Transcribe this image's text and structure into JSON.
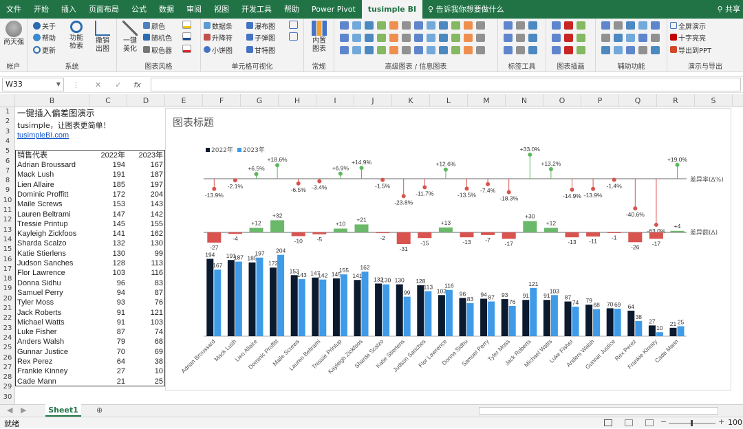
{
  "menu": {
    "tabs": [
      "文件",
      "开始",
      "插入",
      "页面布局",
      "公式",
      "数据",
      "审阅",
      "视图",
      "开发工具",
      "帮助",
      "Power Pivot",
      "tusimple BI"
    ],
    "active_tab": "tusimple BI",
    "tell_me": "告诉我你想要做什么",
    "share": "共享"
  },
  "ribbon": {
    "account": {
      "user": "尚天强",
      "group": "帐户"
    },
    "system": {
      "about": "关于",
      "help": "帮助",
      "update": "更新",
      "search": "功能检索",
      "undo": "撤销出图",
      "group": "系统"
    },
    "chart_style": {
      "beautify": "一键美化",
      "color": "颜色",
      "random_color": "随机色",
      "picker": "取色器",
      "group": "图表风格"
    },
    "cell_viz": {
      "databar": "数据条",
      "updown": "升降符",
      "pie": "小饼图",
      "waterfall": "瀑布图",
      "bullet": "子弹图",
      "sparkline": "甘特图",
      "group": "单元格可视化"
    },
    "common": {
      "builtin": "内置图表",
      "group": "常规"
    },
    "advanced": {
      "group": "高级图表 / 信息图表"
    },
    "label": {
      "group": "标签工具"
    },
    "theme": {
      "group": "图表插画"
    },
    "assist": {
      "group": "辅助功能"
    },
    "export": {
      "fullscreen": "全屏演示",
      "crosshair": "十字亮亮",
      "ppt": "导出到PPT",
      "group": "演示与导出"
    }
  },
  "formula_bar": {
    "name_box": "W33",
    "fx": "fx",
    "cancel": "✕",
    "confirm": "✓"
  },
  "columns": [
    "B",
    "C",
    "D",
    "E",
    "F",
    "G",
    "H",
    "I",
    "J",
    "K",
    "L",
    "M",
    "N",
    "O",
    "P",
    "Q",
    "R",
    "S"
  ],
  "rows": [
    "1",
    "2",
    "3",
    "4",
    "5",
    "6",
    "7",
    "8",
    "9",
    "10",
    "11",
    "12",
    "13",
    "14",
    "15",
    "16",
    "17",
    "18",
    "19",
    "20",
    "21",
    "22",
    "23",
    "24",
    "25",
    "26",
    "27",
    "28",
    "29",
    "30"
  ],
  "sheet": {
    "title": "一键插入偏差图演示",
    "subtitle": "tusimple，让图表更简单！",
    "link": "tusimpleBI.com",
    "header": {
      "name": "销售代表",
      "y2022": "2022年",
      "y2023": "2023年"
    },
    "data": [
      {
        "name": "Adrian Broussard",
        "y2022": 194,
        "y2023": 167
      },
      {
        "name": "Mack Lush",
        "y2022": 191,
        "y2023": 187
      },
      {
        "name": "Lien Allaire",
        "y2022": 185,
        "y2023": 197
      },
      {
        "name": "Dominic Proffitt",
        "y2022": 172,
        "y2023": 204
      },
      {
        "name": "Maile Screws",
        "y2022": 153,
        "y2023": 143
      },
      {
        "name": "Lauren Beltrami",
        "y2022": 147,
        "y2023": 142
      },
      {
        "name": "Tressie Printup",
        "y2022": 145,
        "y2023": 155
      },
      {
        "name": "Kayleigh Zickfoos",
        "y2022": 141,
        "y2023": 162
      },
      {
        "name": "Sharda Scalzo",
        "y2022": 132,
        "y2023": 130
      },
      {
        "name": "Katie Stierlens",
        "y2022": 130,
        "y2023": 99
      },
      {
        "name": "Judson Sanches",
        "y2022": 128,
        "y2023": 113
      },
      {
        "name": "Flor Lawrence",
        "y2022": 103,
        "y2023": 116
      },
      {
        "name": "Donna Sidhu",
        "y2022": 96,
        "y2023": 83
      },
      {
        "name": "Samuel Perry",
        "y2022": 94,
        "y2023": 87
      },
      {
        "name": "Tyler Moss",
        "y2022": 93,
        "y2023": 76
      },
      {
        "name": "Jack Roberts",
        "y2022": 91,
        "y2023": 121
      },
      {
        "name": "Michael Watts",
        "y2022": 91,
        "y2023": 103
      },
      {
        "name": "Luke Fisher",
        "y2022": 87,
        "y2023": 74
      },
      {
        "name": "Anders Walsh",
        "y2022": 79,
        "y2023": 68
      },
      {
        "name": "Gunnar Justice",
        "y2022": 70,
        "y2023": 69
      },
      {
        "name": "Rex Perez",
        "y2022": 64,
        "y2023": 38
      },
      {
        "name": "Frankie Kinney",
        "y2022": 27,
        "y2023": 10
      },
      {
        "name": "Cade Mann",
        "y2022": 21,
        "y2023": 25
      }
    ]
  },
  "chart_data": {
    "type": "bar",
    "title": "图表标题",
    "categories": [
      "Adrian Broussard",
      "Mack Lush",
      "Lien Allaire",
      "Dominic Proffitt",
      "Maile Screws",
      "Lauren Beltrami",
      "Tressie Printup",
      "Kayleigh Zickfoos",
      "Sharda Scalzo",
      "Katie Stierlens",
      "Judson Sanches",
      "Flor Lawrence",
      "Donna Sidhu",
      "Samuel Perry",
      "Tyler Moss",
      "Jack Roberts",
      "Michael Watts",
      "Luke Fisher",
      "Anders Walsh",
      "Gunnar Justice",
      "Rex Perez",
      "Frankie Kinney",
      "Cade Mann"
    ],
    "series": [
      {
        "name": "2022年",
        "color": "#0b1a2e",
        "values": [
          194,
          191,
          185,
          172,
          153,
          147,
          145,
          141,
          132,
          130,
          128,
          103,
          96,
          94,
          93,
          91,
          91,
          87,
          79,
          70,
          64,
          27,
          21
        ]
      },
      {
        "name": "2023年",
        "color": "#3f9be8",
        "values": [
          167,
          187,
          197,
          204,
          143,
          142,
          155,
          162,
          130,
          99,
          113,
          116,
          83,
          87,
          76,
          121,
          103,
          74,
          68,
          69,
          38,
          10,
          25
        ]
      }
    ],
    "diff": [
      -27,
      -4,
      12,
      32,
      -10,
      -5,
      10,
      21,
      -2,
      -31,
      -15,
      13,
      -13,
      -7,
      -17,
      30,
      12,
      -13,
      -11,
      -1,
      -26,
      -17,
      4
    ],
    "diff_labels": [
      "-27",
      "-4",
      "+12",
      "+32",
      "-10",
      "-5",
      "+10",
      "+21",
      "-2",
      "-31",
      "-15",
      "+13",
      "-13",
      "-7",
      "-17",
      "+30",
      "+12",
      "-13",
      "-11",
      "-1",
      "-26",
      "-17",
      "+4"
    ],
    "rate": [
      -13.9,
      -2.1,
      6.5,
      18.6,
      -6.5,
      -3.4,
      6.9,
      14.9,
      -1.5,
      -23.8,
      -11.7,
      12.6,
      -13.5,
      -7.4,
      -18.3,
      33.0,
      13.2,
      -14.9,
      -13.9,
      -1.4,
      -40.6,
      -63.0,
      19.0
    ],
    "rate_labels": [
      "-13.9%",
      "-2.1%",
      "+6.5%",
      "+18.6%",
      "-6.5%",
      "-3.4%",
      "+6.9%",
      "+14.9%",
      "-1.5%",
      "-23.8%",
      "-11.7%",
      "+12.6%",
      "-13.5%",
      "-7.4%",
      "-18.3%",
      "+33.0%",
      "+13.2%",
      "-14.9%",
      "-13.9%",
      "-1.4%",
      "-40.6%",
      "-63.0%",
      "+19.0%"
    ],
    "rate_axis_label": "差异率(Δ%)",
    "diff_axis_label": "差异额(Δ)",
    "legend_position": "top-left",
    "colors": {
      "positive_bar": "#6ab86a",
      "negative_bar": "#d9534f",
      "pos_dot": "#5cb85c",
      "neg_dot": "#d9534f"
    }
  },
  "sheet_tabs": {
    "active": "Sheet1",
    "add": "⊕"
  },
  "status": {
    "ready": "就绪",
    "zoom": "100"
  }
}
